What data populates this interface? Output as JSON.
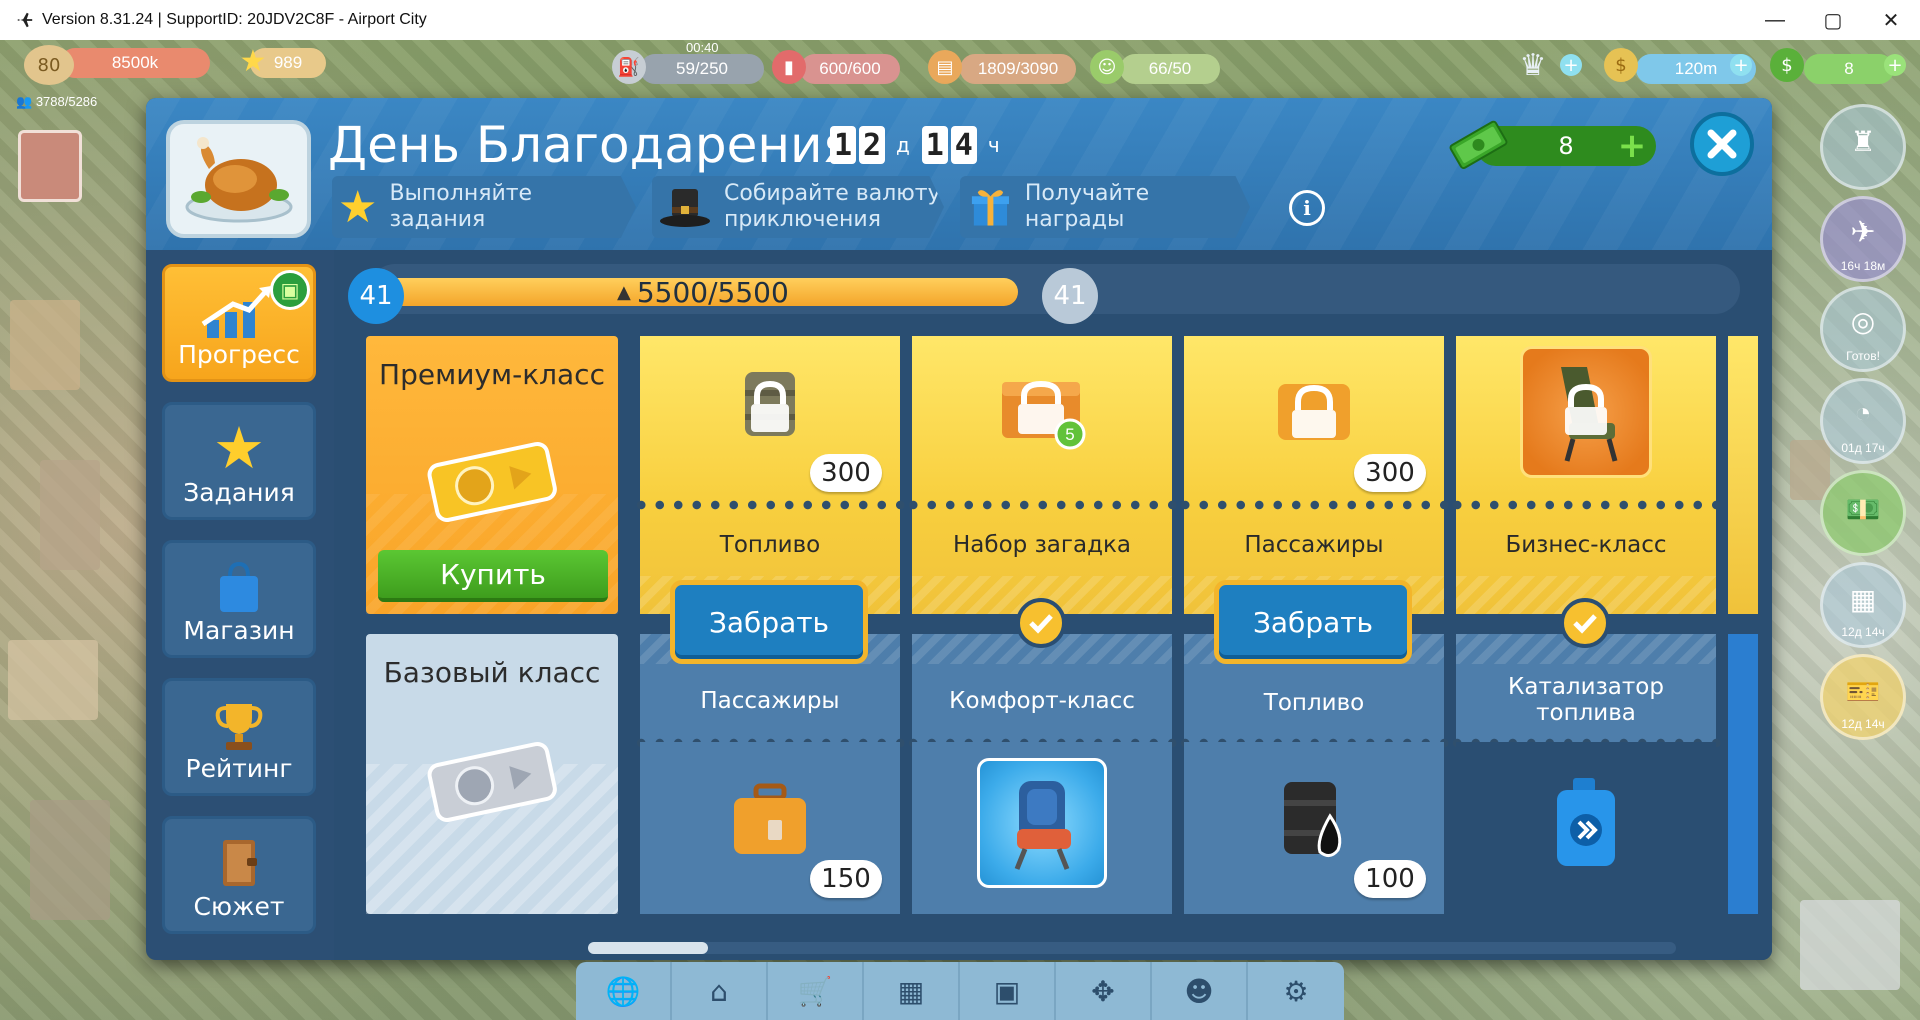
{
  "window": {
    "title": "Version 8.31.24 | SupportID: 20JDV2C8F - Airport City",
    "minimize": "—",
    "maximize": "▢",
    "close": "✕"
  },
  "hud": {
    "level": "80",
    "xp": "8500k",
    "stars": "989",
    "population": "3788/5286",
    "fuel_timer": "00:40",
    "fuel": "59/250",
    "resource2": "600/600",
    "resource3": "1809/3090",
    "resource4": "66/50",
    "coins": "120m",
    "cash": "8"
  },
  "dialog": {
    "title": "День Благодарения",
    "timer": {
      "days_d1": "1",
      "days_d2": "2",
      "days_unit": "д",
      "hours_d1": "1",
      "hours_d2": "4",
      "hours_unit": "ч"
    },
    "tabs": [
      {
        "label": "Выполняйте задания"
      },
      {
        "label": "Собирайте валюту приключения"
      },
      {
        "label": "Получайте награды"
      }
    ],
    "info": "i",
    "cash_counter": "8"
  },
  "sidebar": {
    "items": [
      {
        "label": "Прогресс",
        "active": true
      },
      {
        "label": "Задания"
      },
      {
        "label": "Магазин"
      },
      {
        "label": "Рейтинг"
      },
      {
        "label": "Сюжет"
      }
    ]
  },
  "progress": {
    "current_level": "41",
    "next_level": "41",
    "text": "5500/5500",
    "fill_fraction": 0.88
  },
  "pass": {
    "premium_title": "Премиум-класс",
    "buy_label": "Купить",
    "basic_title": "Базовый класс"
  },
  "columns": [
    {
      "premium_label": "Топливо",
      "premium_count": "300",
      "premium_icon": "fuel-barrel-locked-icon",
      "claim": "Забрать",
      "basic_label": "Пассажиры",
      "basic_count": "150",
      "basic_icon": "suitcase-icon"
    },
    {
      "premium_label": "Набор загадка",
      "premium_count": "5",
      "premium_icon": "mystery-basket-locked-icon",
      "basic_label": "Комфорт-класс",
      "basic_icon": "comfort-seat-icon"
    },
    {
      "premium_label": "Пассажиры",
      "premium_count": "300",
      "premium_icon": "suitcase-locked-icon",
      "claim": "Забрать",
      "basic_label": "Топливо",
      "basic_count": "100",
      "basic_icon": "oil-barrel-icon"
    },
    {
      "premium_label": "Бизнес-класс",
      "premium_icon": "business-seat-locked-icon",
      "basic_label": "Катализатор топлива",
      "basic_icon": "fuel-catalyst-canister-icon"
    }
  ],
  "right_floaters": [
    {
      "label": ""
    },
    {
      "label": "16ч 18м"
    },
    {
      "label": "Готов!"
    },
    {
      "label": "01д 17ч"
    },
    {
      "label": ""
    },
    {
      "label": "12д 14ч"
    },
    {
      "label": "12д 14ч"
    }
  ],
  "bottom_bar": [
    {
      "icon": "globe-plane-icon"
    },
    {
      "icon": "hangar-icon"
    },
    {
      "icon": "cart-icon"
    },
    {
      "icon": "crate-icon"
    },
    {
      "icon": "chest-icon"
    },
    {
      "icon": "move-arrows-icon"
    },
    {
      "icon": "friends-icon"
    },
    {
      "icon": "settings-gear-icon"
    }
  ],
  "colors": {
    "header_blue": "#3b87c4",
    "premium_yellow": "#f8cf3e",
    "premium_orange": "#f9a428",
    "claim_blue": "#1e7fc0",
    "buy_green": "#3e9d1d"
  }
}
